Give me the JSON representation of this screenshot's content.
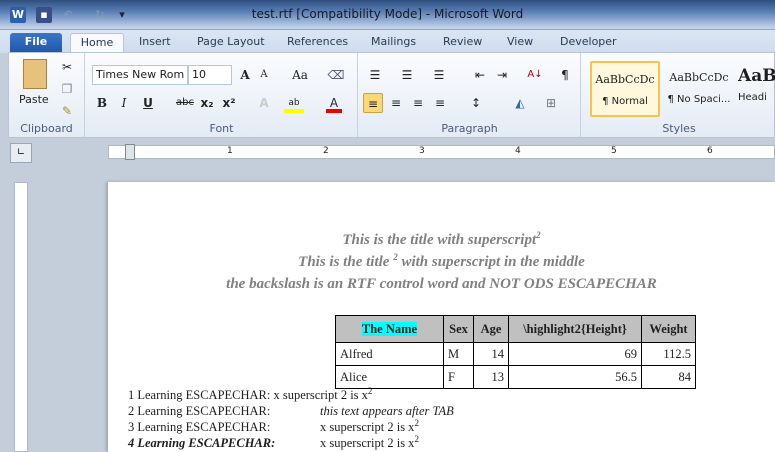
{
  "window": {
    "title": "test.rtf [Compatibility Mode]  -  Microsoft Word"
  },
  "tabs": [
    "File",
    "Home",
    "Insert",
    "Page Layout",
    "References",
    "Mailings",
    "Review",
    "View",
    "Developer"
  ],
  "ribbon": {
    "clipboard": {
      "label": "Clipboard",
      "paste": "Paste"
    },
    "font": {
      "label": "Font",
      "name": "Times New Rom",
      "size": "10"
    },
    "paragraph": {
      "label": "Paragraph"
    },
    "styles": {
      "label": "Styles",
      "items": [
        {
          "preview": "AaBbCcDc",
          "name": "¶ Normal"
        },
        {
          "preview": "AaBbCcDc",
          "name": "¶ No Spaci..."
        },
        {
          "preview": "AaB",
          "name": "Headi"
        }
      ]
    }
  },
  "ruler": {
    "labels": [
      "1",
      "2",
      "3",
      "4",
      "5",
      "6"
    ]
  },
  "document": {
    "titles": [
      {
        "text": "This is the title with superscript",
        "sup": "2",
        "after": ""
      },
      {
        "text": "This is the title ",
        "sup": "2",
        "after": " with superscript in the middle"
      },
      {
        "text": "the backslash is an RTF control word and NOT ODS ESCAPECHAR",
        "sup": "",
        "after": ""
      }
    ],
    "table": {
      "headers": [
        "The Name",
        "Sex",
        "Age",
        "\\highlight2{Height}",
        "Weight"
      ],
      "rows": [
        [
          "Alfred",
          "M",
          "14",
          "69",
          "112.5"
        ],
        [
          "Alice",
          "F",
          "13",
          "56.5",
          "84"
        ]
      ]
    },
    "lines": [
      {
        "label": "1 Learning ESCAPECHAR:",
        "text": "x superscript 2 is x",
        "sup": "2"
      },
      {
        "label": "2 Learning ESCAPECHAR:",
        "text": "this text appears after TAB",
        "sup": ""
      },
      {
        "label": "3 Learning ESCAPECHAR:",
        "text": "x superscript 2 is x",
        "sup": "2"
      },
      {
        "label": "4 Learning ESCAPECHAR:",
        "text": "x superscript 2 is x",
        "sup": "2"
      }
    ]
  },
  "colors": {
    "title_gray": "#808080",
    "header_bg": "#c0c0c0",
    "highlight": "#00ffff",
    "file_tab": "#2a62b4"
  }
}
